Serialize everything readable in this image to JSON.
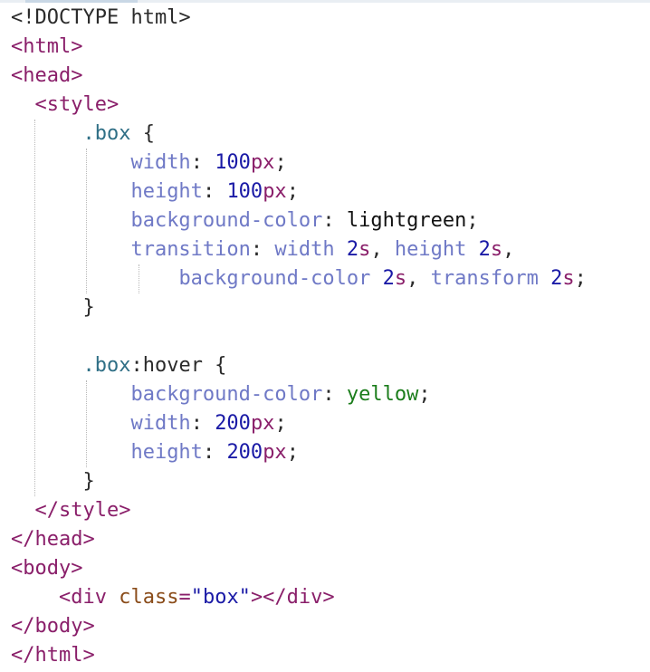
{
  "editor": {
    "lines": [
      [
        {
          "t": "<!DOCTYPE html>",
          "c": "punc"
        }
      ],
      [
        {
          "t": "<html>",
          "c": "tag"
        }
      ],
      [
        {
          "t": "<head>",
          "c": "tag"
        }
      ],
      [
        {
          "t": "  ",
          "c": "punc"
        },
        {
          "t": "<style>",
          "c": "tag"
        }
      ],
      [
        {
          "t": "      ",
          "c": "punc"
        },
        {
          "t": ".box",
          "c": "sel"
        },
        {
          "t": " {",
          "c": "punc"
        }
      ],
      [
        {
          "t": "          ",
          "c": "punc"
        },
        {
          "t": "width",
          "c": "prop"
        },
        {
          "t": ": ",
          "c": "punc"
        },
        {
          "t": "100",
          "c": "num"
        },
        {
          "t": "px",
          "c": "unit"
        },
        {
          "t": ";",
          "c": "punc"
        }
      ],
      [
        {
          "t": "          ",
          "c": "punc"
        },
        {
          "t": "height",
          "c": "prop"
        },
        {
          "t": ": ",
          "c": "punc"
        },
        {
          "t": "100",
          "c": "num"
        },
        {
          "t": "px",
          "c": "unit"
        },
        {
          "t": ";",
          "c": "punc"
        }
      ],
      [
        {
          "t": "          ",
          "c": "punc"
        },
        {
          "t": "background-color",
          "c": "prop"
        },
        {
          "t": ": ",
          "c": "punc"
        },
        {
          "t": "lightgreen",
          "c": "text"
        },
        {
          "t": ";",
          "c": "punc"
        }
      ],
      [
        {
          "t": "          ",
          "c": "punc"
        },
        {
          "t": "transition",
          "c": "prop"
        },
        {
          "t": ": ",
          "c": "punc"
        },
        {
          "t": "width",
          "c": "prop"
        },
        {
          "t": " ",
          "c": "punc"
        },
        {
          "t": "2",
          "c": "num"
        },
        {
          "t": "s",
          "c": "unit"
        },
        {
          "t": ", ",
          "c": "punc"
        },
        {
          "t": "height",
          "c": "prop"
        },
        {
          "t": " ",
          "c": "punc"
        },
        {
          "t": "2",
          "c": "num"
        },
        {
          "t": "s",
          "c": "unit"
        },
        {
          "t": ",",
          "c": "punc"
        }
      ],
      [
        {
          "t": "              ",
          "c": "punc"
        },
        {
          "t": "background-color",
          "c": "prop"
        },
        {
          "t": " ",
          "c": "punc"
        },
        {
          "t": "2",
          "c": "num"
        },
        {
          "t": "s",
          "c": "unit"
        },
        {
          "t": ", ",
          "c": "punc"
        },
        {
          "t": "transform",
          "c": "prop"
        },
        {
          "t": " ",
          "c": "punc"
        },
        {
          "t": "2",
          "c": "num"
        },
        {
          "t": "s",
          "c": "unit"
        },
        {
          "t": ";",
          "c": "punc"
        }
      ],
      [
        {
          "t": "      ",
          "c": "punc"
        },
        {
          "t": "}",
          "c": "punc"
        }
      ],
      [],
      [
        {
          "t": "      ",
          "c": "punc"
        },
        {
          "t": ".box",
          "c": "sel"
        },
        {
          "t": ":hover {",
          "c": "punc"
        }
      ],
      [
        {
          "t": "          ",
          "c": "punc"
        },
        {
          "t": "background-color",
          "c": "prop"
        },
        {
          "t": ": ",
          "c": "punc"
        },
        {
          "t": "yellow",
          "c": "kw"
        },
        {
          "t": ";",
          "c": "punc"
        }
      ],
      [
        {
          "t": "          ",
          "c": "punc"
        },
        {
          "t": "width",
          "c": "prop"
        },
        {
          "t": ": ",
          "c": "punc"
        },
        {
          "t": "200",
          "c": "num"
        },
        {
          "t": "px",
          "c": "unit"
        },
        {
          "t": ";",
          "c": "punc"
        }
      ],
      [
        {
          "t": "          ",
          "c": "punc"
        },
        {
          "t": "height",
          "c": "prop"
        },
        {
          "t": ": ",
          "c": "punc"
        },
        {
          "t": "200",
          "c": "num"
        },
        {
          "t": "px",
          "c": "unit"
        },
        {
          "t": ";",
          "c": "punc"
        }
      ],
      [
        {
          "t": "      ",
          "c": "punc"
        },
        {
          "t": "}",
          "c": "punc"
        }
      ],
      [
        {
          "t": "  ",
          "c": "punc"
        },
        {
          "t": "</style>",
          "c": "tag"
        }
      ],
      [
        {
          "t": "</head>",
          "c": "tag"
        }
      ],
      [
        {
          "t": "<body>",
          "c": "tag"
        }
      ],
      [
        {
          "t": "    ",
          "c": "punc"
        },
        {
          "t": "<div ",
          "c": "tag"
        },
        {
          "t": "class",
          "c": "attr"
        },
        {
          "t": "=",
          "c": "tag"
        },
        {
          "t": "\"box\"",
          "c": "str"
        },
        {
          "t": "></div>",
          "c": "tag"
        }
      ],
      [
        {
          "t": "</body>",
          "c": "tag"
        }
      ],
      [
        {
          "t": "</html>",
          "c": "tag"
        }
      ]
    ]
  },
  "colors": {
    "punctuation": "#2b2b2b",
    "tag": "#8a1f6a",
    "selector": "#2f6f86",
    "property": "#6f79c6",
    "number": "#1a1aa6",
    "unit": "#8a1f6a",
    "attribute": "#8a4c1a",
    "string": "#1a1aa6",
    "keyword": "#1b7d1b",
    "plain_text": "#111111"
  }
}
